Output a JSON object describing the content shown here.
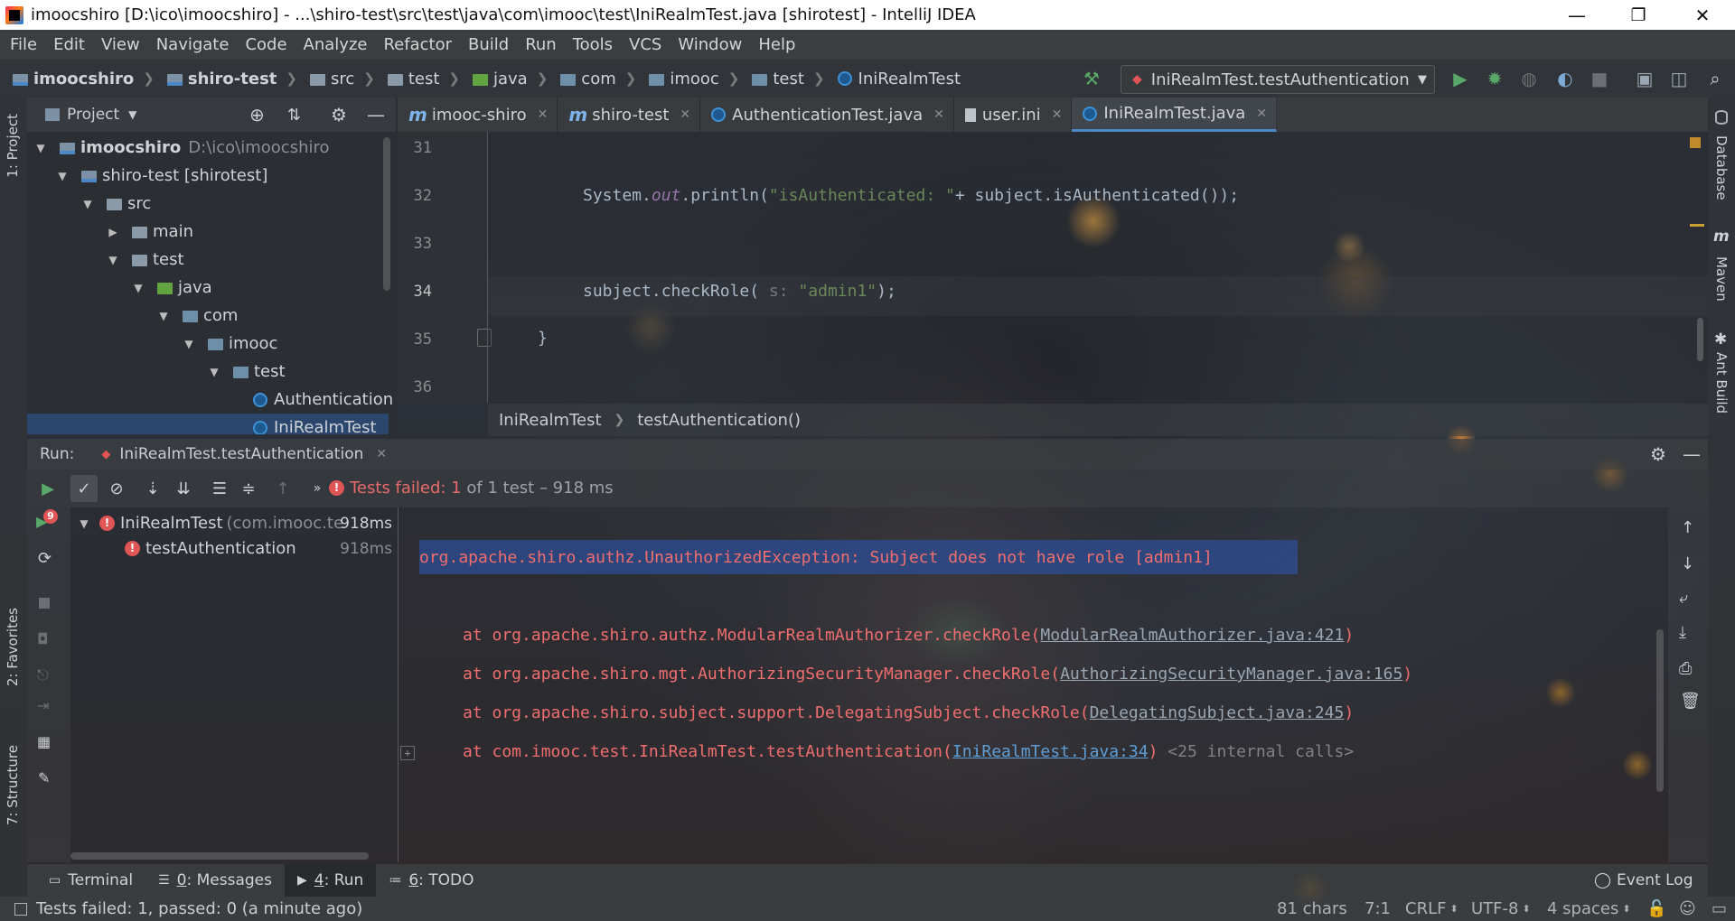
{
  "window": {
    "title": "imoocshiro [D:\\ico\\imoocshiro] - ...\\shiro-test\\src\\test\\java\\com\\imooc\\test\\IniRealmTest.java [shirotest] - IntelliJ IDEA",
    "minimize": "—",
    "maximize": "❐",
    "close": "✕"
  },
  "menu": [
    "File",
    "Edit",
    "View",
    "Navigate",
    "Code",
    "Analyze",
    "Refactor",
    "Build",
    "Run",
    "Tools",
    "VCS",
    "Window",
    "Help"
  ],
  "breadcrumb": [
    "imoocshiro",
    "shiro-test",
    "src",
    "test",
    "java",
    "com",
    "imooc",
    "test",
    "IniRealmTest"
  ],
  "run_config": "IniRealmTest.testAuthentication",
  "side_tabs": {
    "project": "1: Project",
    "favorites": "2: Favorites",
    "structure": "7: Structure",
    "database": "Database",
    "maven": "Maven",
    "ant": "Ant Build"
  },
  "project_panel": {
    "title": "Project",
    "tree": [
      {
        "label": "imoocshiro",
        "extra": "D:\\ico\\imoocshiro",
        "arrow": "▼"
      },
      {
        "label": "shiro-test [shirotest]",
        "extra": "",
        "arrow": "▼"
      },
      {
        "label": "src",
        "extra": "",
        "arrow": "▼"
      },
      {
        "label": "main",
        "extra": "",
        "arrow": "▶"
      },
      {
        "label": "test",
        "extra": "",
        "arrow": "▼"
      },
      {
        "label": "java",
        "extra": "",
        "arrow": "▼"
      },
      {
        "label": "com",
        "extra": "",
        "arrow": "▼"
      },
      {
        "label": "imooc",
        "extra": "",
        "arrow": "▼"
      },
      {
        "label": "test",
        "extra": "",
        "arrow": "▼"
      },
      {
        "label": "Authentication",
        "extra": "",
        "arrow": ""
      },
      {
        "label": "IniRealmTest",
        "extra": "",
        "arrow": ""
      }
    ]
  },
  "editor_tabs": [
    "imooc-shiro",
    "shiro-test",
    "AuthenticationTest.java",
    "user.ini",
    "IniRealmTest.java"
  ],
  "code": {
    "line_numbers": [
      "31",
      "32",
      "33",
      "34",
      "35",
      "36"
    ],
    "line32_a": "System.",
    "line32_field": "out",
    "line32_b": ".println(",
    "line32_str": "\"isAuthenticated: \"",
    "line32_c": "+ subject.isAuthenticated());",
    "line34_a": "subject.checkRole(",
    "line34_hint": " s: ",
    "line34_str": "\"admin1\"",
    "line34_b": ");",
    "line35": "}"
  },
  "editor_crumbs": [
    "IniRealmTest",
    "testAuthentication()"
  ],
  "run": {
    "label": "Run:",
    "config": "IniRealmTest.testAuthentication",
    "status_prefix": "Tests failed:",
    "status_count": "1",
    "status_suffix": "of 1 test – 918 ms",
    "tree": [
      {
        "label": "IniRealmTest",
        "extra": "(com.imooc.te",
        "time": "918ms"
      },
      {
        "label": "testAuthentication",
        "extra": "",
        "time": "918ms"
      }
    ],
    "failed_badge": "9"
  },
  "console": {
    "exception": "org.apache.shiro.authz.UnauthorizedException: Subject does not have role [admin1]",
    "frames": [
      {
        "text": "at org.apache.shiro.authz.ModularRealmAuthorizer.checkRole(",
        "link": "ModularRealmAuthorizer.java:421",
        "end": ")",
        "extra": ""
      },
      {
        "text": "at org.apache.shiro.mgt.AuthorizingSecurityManager.checkRole(",
        "link": "AuthorizingSecurityManager.java:165",
        "end": ")",
        "extra": ""
      },
      {
        "text": "at org.apache.shiro.subject.support.DelegatingSubject.checkRole(",
        "link": "DelegatingSubject.java:245",
        "end": ")",
        "extra": ""
      },
      {
        "text": "at com.imooc.test.IniRealmTest.testAuthentication(",
        "link": "IniRealmTest.java:34",
        "end": ")",
        "extra": "<25 internal calls>"
      }
    ]
  },
  "tool_windows": [
    {
      "num": "",
      "label": "Terminal"
    },
    {
      "num": "0",
      "label": ": Messages"
    },
    {
      "num": "4",
      "label": ": Run"
    },
    {
      "num": "6",
      "label": ": TODO"
    }
  ],
  "event_log": "Event Log",
  "status": {
    "message": "Tests failed: 1, passed: 0 (a minute ago)",
    "chars": "81 chars",
    "position": "7:1",
    "line_sep": "CRLF",
    "encoding": "UTF-8",
    "indent": "4 spaces"
  },
  "colors": {
    "accent": "#4a88c7",
    "error": "#e05555",
    "run_green": "#59a869",
    "string": "#6a8759",
    "field": "#9876aa"
  }
}
